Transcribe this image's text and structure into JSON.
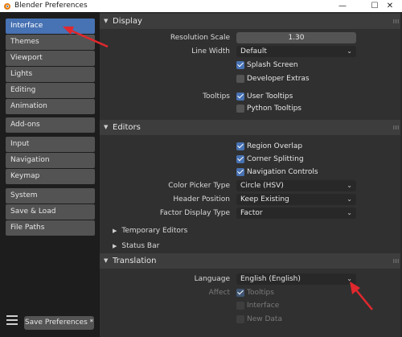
{
  "window": {
    "title": "Blender Preferences",
    "min": "—",
    "max": "☐",
    "close": "✕"
  },
  "sidebar": {
    "groups": [
      [
        {
          "label": "Interface",
          "active": true
        },
        {
          "label": "Themes"
        },
        {
          "label": "Viewport"
        },
        {
          "label": "Lights"
        },
        {
          "label": "Editing"
        },
        {
          "label": "Animation"
        }
      ],
      [
        {
          "label": "Add-ons"
        }
      ],
      [
        {
          "label": "Input"
        },
        {
          "label": "Navigation"
        },
        {
          "label": "Keymap"
        }
      ],
      [
        {
          "label": "System"
        },
        {
          "label": "Save & Load"
        },
        {
          "label": "File Paths"
        }
      ]
    ],
    "save_button": "Save Preferences *"
  },
  "display": {
    "header": "Display",
    "resolution_scale_label": "Resolution Scale",
    "resolution_scale_value": "1.30",
    "line_width_label": "Line Width",
    "line_width_value": "Default",
    "splash_screen": "Splash Screen",
    "developer_extras": "Developer Extras",
    "tooltips_label": "Tooltips",
    "user_tooltips": "User Tooltips",
    "python_tooltips": "Python Tooltips"
  },
  "editors": {
    "header": "Editors",
    "region_overlap": "Region Overlap",
    "corner_splitting": "Corner Splitting",
    "navigation_controls": "Navigation Controls",
    "color_picker_label": "Color Picker Type",
    "color_picker_value": "Circle (HSV)",
    "header_position_label": "Header Position",
    "header_position_value": "Keep Existing",
    "factor_display_label": "Factor Display Type",
    "factor_display_value": "Factor",
    "temporary_editors": "Temporary Editors",
    "status_bar": "Status Bar"
  },
  "translation": {
    "header": "Translation",
    "language_label": "Language",
    "language_value": "English (English)",
    "affect_label": "Affect",
    "tooltips": "Tooltips",
    "interface": "Interface",
    "new_data": "New Data"
  },
  "icons": {
    "panel_open": "▼",
    "panel_closed": "▶",
    "dropdown": "⌄"
  },
  "colors": {
    "accent": "#4772b3",
    "annotation": "#e0282e"
  }
}
